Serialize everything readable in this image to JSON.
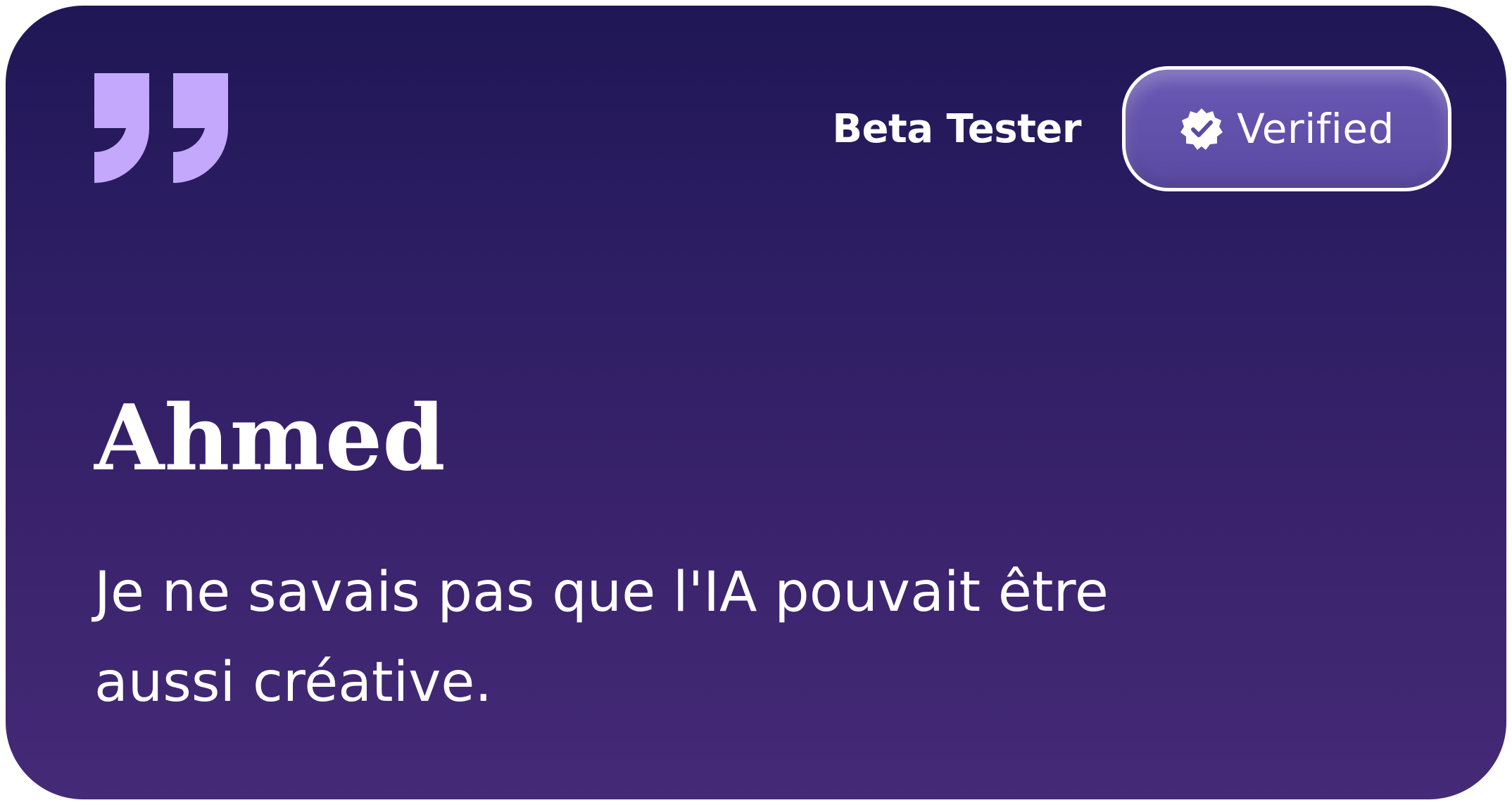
{
  "card": {
    "name": "Ahmed",
    "quote": "Je ne savais pas que l'IA pouvait être aussi créative.",
    "role_label": "Beta Tester",
    "verified_label": "Verified",
    "quote_icon": "quote-mark-icon",
    "verified_icon": "verified-badge-icon"
  },
  "colors": {
    "background_top": "#1f1755",
    "background_bottom": "#452a77",
    "quote_mark": "#c3a8fb",
    "pill": "#5f4fa9",
    "text": "#ffffff"
  }
}
